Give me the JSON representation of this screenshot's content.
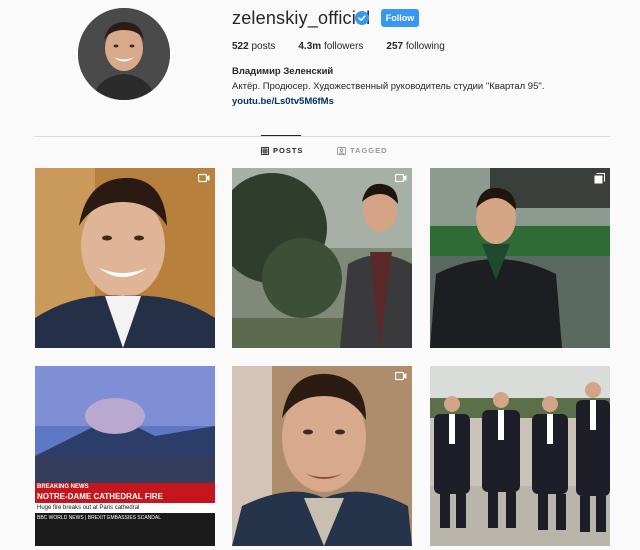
{
  "profile": {
    "username": "zelenskiy_official",
    "follow_label": "Follow",
    "stats": [
      {
        "value": "522",
        "label": "posts"
      },
      {
        "value": "4.3m",
        "label": "followers"
      },
      {
        "value": "257",
        "label": "following"
      }
    ],
    "full_name": "Владимир Зеленский",
    "bio": "Актёр. Продюсер. Художественный руководитель студии \"Квартал 95\".",
    "link": "youtu.be/Ls0tv5M6fMs"
  },
  "tabs": [
    {
      "label": "POSTS",
      "icon": "grid-icon",
      "active": true
    },
    {
      "label": "TAGGED",
      "icon": "tag-icon",
      "active": false
    }
  ],
  "colors": {
    "accent": "#3897f0",
    "link": "#003569",
    "news_red": "#c4161c"
  },
  "posts": [
    {
      "media_icon": "video-icon"
    },
    {
      "media_icon": "video-icon"
    },
    {
      "media_icon": "carousel-icon"
    },
    {
      "media_icon": "none",
      "overlay_text": [
        "BREAKING NEWS",
        "NOTRE-DAME CATHEDRAL FIRE",
        "Huge fire breaks out at Paris cathedral",
        "BBC WORLD NEWS | BREXIT EMBASSIES SCANDAL"
      ]
    },
    {
      "media_icon": "video-icon"
    },
    {
      "media_icon": "video-icon"
    }
  ]
}
